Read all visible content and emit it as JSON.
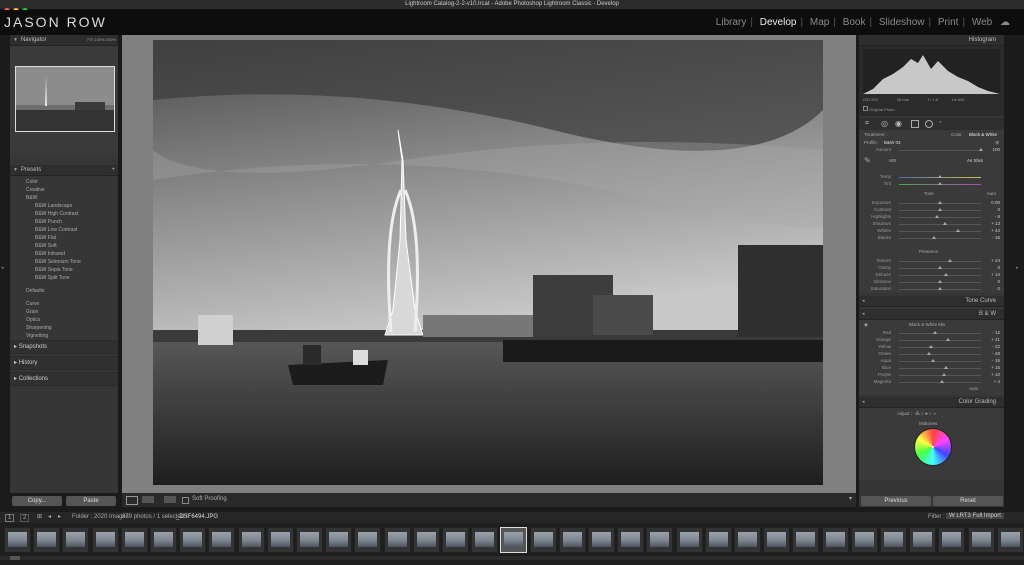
{
  "window": {
    "title": "Lightroom Catalog-2-2-v10.lrcat - Adobe Photoshop Lightroom Classic - Develop"
  },
  "identity": {
    "logo": "JASON ROW"
  },
  "modules": [
    {
      "label": "Library"
    },
    {
      "label": "Develop"
    },
    {
      "label": "Map"
    },
    {
      "label": "Book"
    },
    {
      "label": "Slideshow"
    },
    {
      "label": "Print"
    },
    {
      "label": "Web"
    }
  ],
  "left": {
    "navigator": {
      "title": "Navigator",
      "zoom": [
        "FIT",
        "100%",
        "200%"
      ]
    },
    "presets": {
      "title": "Presets",
      "groups": [
        "Color",
        "Creative",
        "B&W"
      ],
      "bw_items": [
        "B&W Landscape",
        "B&W High Contrast",
        "B&W Punch",
        "B&W Low Contrast",
        "B&W Flat",
        "B&W Soft",
        "B&W Infrared",
        "B&W Selenium Tone",
        "B&W Sepia Tone",
        "B&W Split Tone"
      ],
      "more_groups": [
        "Defaults",
        "Curve",
        "Grain",
        "Optics",
        "Sharpening",
        "Vignetting"
      ]
    },
    "snapshots": "Snapshots",
    "history": "History",
    "collections": "Collections",
    "copy_btn": "Copy...",
    "paste_btn": "Paste"
  },
  "toolbar": {
    "soft_proofing": "Soft Proofing"
  },
  "right": {
    "histogram": {
      "title": "Histogram",
      "iso": "ISO 200",
      "focal": "16 mm",
      "aperture": "f / 1.6",
      "shutter": "1/s 640",
      "original_photo": "Original Photo"
    },
    "basic": {
      "treatment": "Treatment :",
      "color": "Color",
      "bw": "Black & White",
      "profile_label": "Profile :",
      "profile_value": "B&W 03",
      "amount_label": "Amount",
      "amount_value": "100",
      "wb_label": "WB :",
      "wb_value": "As Shot",
      "temp": "Temp",
      "tint": "Tint",
      "tone": "Tone",
      "auto": "Auto",
      "presence": "Presence"
    },
    "basic_sliders": [
      {
        "label": "Exposure",
        "value": "0.00",
        "pos": 0.5
      },
      {
        "label": "Contrast",
        "value": "0",
        "pos": 0.5
      },
      {
        "label": "Highlights",
        "value": "- 8",
        "pos": 0.46
      },
      {
        "label": "Shadows",
        "value": "+ 13",
        "pos": 0.56
      },
      {
        "label": "Whites",
        "value": "+ 44",
        "pos": 0.72
      },
      {
        "label": "Blacks",
        "value": "- 15",
        "pos": 0.43
      }
    ],
    "presence_sliders": [
      {
        "label": "Texture",
        "value": "+ 24",
        "pos": 0.62
      },
      {
        "label": "Clarity",
        "value": "0",
        "pos": 0.5
      },
      {
        "label": "Dehaze",
        "value": "+ 14",
        "pos": 0.57
      },
      {
        "label": "Vibrance",
        "value": "0",
        "pos": 0.5
      },
      {
        "label": "Saturation",
        "value": "0",
        "pos": 0.5
      }
    ],
    "tone_curve": "Tone Curve",
    "bw_panel": "B & W",
    "bw_mix": "Black & White Mix",
    "bw_sliders": [
      {
        "label": "Red",
        "value": "- 12",
        "pos": 0.44
      },
      {
        "label": "Orange",
        "value": "+ 21",
        "pos": 0.6
      },
      {
        "label": "Yellow",
        "value": "- 22",
        "pos": 0.39
      },
      {
        "label": "Green",
        "value": "- 28",
        "pos": 0.36
      },
      {
        "label": "Aqua",
        "value": "- 16",
        "pos": 0.42
      },
      {
        "label": "Blue",
        "value": "+ 15",
        "pos": 0.57
      },
      {
        "label": "Purple",
        "value": "+ 10",
        "pos": 0.55
      },
      {
        "label": "Magenta",
        "value": "+ 4",
        "pos": 0.52
      }
    ],
    "bw_auto": "Auto",
    "color_grading": "Color Grading",
    "adjust": "Adjust :",
    "midtones": "Midtones",
    "previous_btn": "Previous",
    "reset_btn": "Reset"
  },
  "filmstrip": {
    "pages": [
      "1",
      "2"
    ],
    "folder": "Folder : 2020 Images",
    "count": "879 photos / 1 selected /",
    "filename": "_DSF6494.JPG",
    "filter_label": "Filter :",
    "filter_value": "W LRT3 Full Import"
  },
  "colors": {
    "accent": "#e0e0e0",
    "panel": "#363636",
    "bg": "#1b1b1b"
  }
}
